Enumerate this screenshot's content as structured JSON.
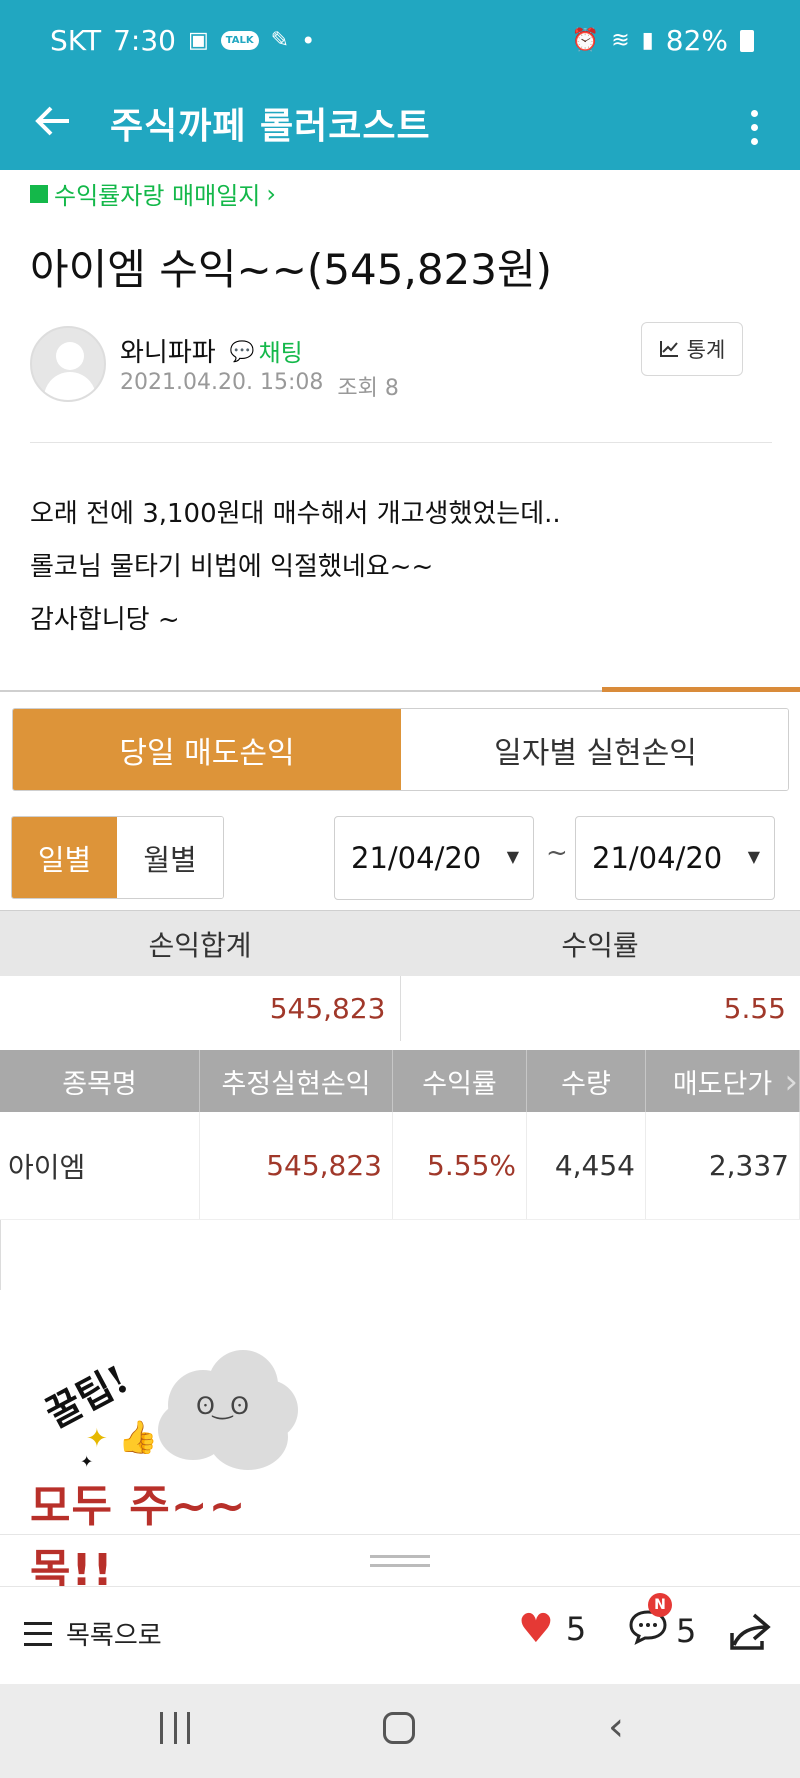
{
  "status_bar": {
    "carrier": "SKT",
    "time": "7:30",
    "talk_label": "TALK",
    "battery": "82%"
  },
  "app_bar": {
    "title": "주식까페 롤러코스트"
  },
  "post": {
    "board": "수익률자랑 매매일지",
    "title": "아이엠 수익~~(545,823원)",
    "author": "와니파파",
    "chat_label": "채팅",
    "date": "2021.04.20. 15:08",
    "views": "조회 8",
    "stats_label": "통계",
    "body_lines": [
      "오래 전에 3,100원대 매수해서 개고생했었는데..",
      "롤코님 물타기 비법에 익절했네요~~",
      "감사합니당 ~"
    ]
  },
  "embed": {
    "tabs": [
      "당일 매도손익",
      "일자별 실현손익"
    ],
    "periods": [
      "일별",
      "월별"
    ],
    "date_from": "21/04/20",
    "date_to": "21/04/20",
    "tilde": "~",
    "summary_headers": [
      "손익합계",
      "수익률"
    ],
    "summary_values": [
      "545,823",
      "5.55"
    ],
    "table_headers": [
      "종목명",
      "추정실현손익",
      "수익률",
      "수량",
      "매도단가"
    ],
    "table_rows": [
      [
        "아이엠",
        "545,823",
        "5.55%",
        "4,454",
        "2,337"
      ]
    ]
  },
  "sticker": {
    "tip": "꿀팁!",
    "text": "모두 주~~목!!"
  },
  "actions": {
    "list_label": "목록으로",
    "likes": "5",
    "comments": "5",
    "comment_badge": "N"
  },
  "colors": {
    "app_bar": "#21a7c1",
    "accent_green": "#14b84a",
    "tab_orange": "#dd9439",
    "value_red": "#a0382a",
    "heart": "#e53935"
  }
}
